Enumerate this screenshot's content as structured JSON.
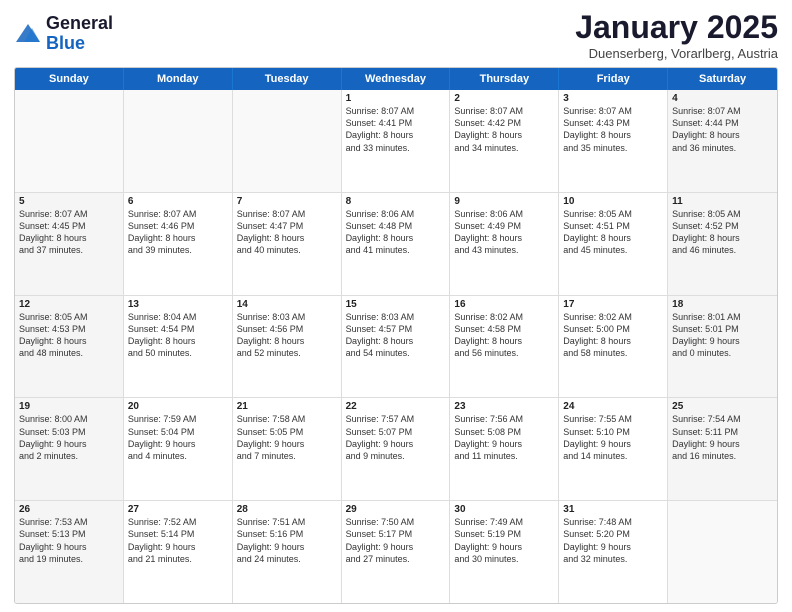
{
  "header": {
    "logo": {
      "general": "General",
      "blue": "Blue"
    },
    "title": "January 2025",
    "location": "Duenserberg, Vorarlberg, Austria"
  },
  "weekdays": [
    "Sunday",
    "Monday",
    "Tuesday",
    "Wednesday",
    "Thursday",
    "Friday",
    "Saturday"
  ],
  "rows": [
    [
      {
        "day": "",
        "text": "",
        "empty": true
      },
      {
        "day": "",
        "text": "",
        "empty": true
      },
      {
        "day": "",
        "text": "",
        "empty": true
      },
      {
        "day": "1",
        "text": "Sunrise: 8:07 AM\nSunset: 4:41 PM\nDaylight: 8 hours\nand 33 minutes."
      },
      {
        "day": "2",
        "text": "Sunrise: 8:07 AM\nSunset: 4:42 PM\nDaylight: 8 hours\nand 34 minutes."
      },
      {
        "day": "3",
        "text": "Sunrise: 8:07 AM\nSunset: 4:43 PM\nDaylight: 8 hours\nand 35 minutes."
      },
      {
        "day": "4",
        "text": "Sunrise: 8:07 AM\nSunset: 4:44 PM\nDaylight: 8 hours\nand 36 minutes.",
        "shaded": true
      }
    ],
    [
      {
        "day": "5",
        "text": "Sunrise: 8:07 AM\nSunset: 4:45 PM\nDaylight: 8 hours\nand 37 minutes.",
        "shaded": true
      },
      {
        "day": "6",
        "text": "Sunrise: 8:07 AM\nSunset: 4:46 PM\nDaylight: 8 hours\nand 39 minutes."
      },
      {
        "day": "7",
        "text": "Sunrise: 8:07 AM\nSunset: 4:47 PM\nDaylight: 8 hours\nand 40 minutes."
      },
      {
        "day": "8",
        "text": "Sunrise: 8:06 AM\nSunset: 4:48 PM\nDaylight: 8 hours\nand 41 minutes."
      },
      {
        "day": "9",
        "text": "Sunrise: 8:06 AM\nSunset: 4:49 PM\nDaylight: 8 hours\nand 43 minutes."
      },
      {
        "day": "10",
        "text": "Sunrise: 8:05 AM\nSunset: 4:51 PM\nDaylight: 8 hours\nand 45 minutes."
      },
      {
        "day": "11",
        "text": "Sunrise: 8:05 AM\nSunset: 4:52 PM\nDaylight: 8 hours\nand 46 minutes.",
        "shaded": true
      }
    ],
    [
      {
        "day": "12",
        "text": "Sunrise: 8:05 AM\nSunset: 4:53 PM\nDaylight: 8 hours\nand 48 minutes.",
        "shaded": true
      },
      {
        "day": "13",
        "text": "Sunrise: 8:04 AM\nSunset: 4:54 PM\nDaylight: 8 hours\nand 50 minutes."
      },
      {
        "day": "14",
        "text": "Sunrise: 8:03 AM\nSunset: 4:56 PM\nDaylight: 8 hours\nand 52 minutes."
      },
      {
        "day": "15",
        "text": "Sunrise: 8:03 AM\nSunset: 4:57 PM\nDaylight: 8 hours\nand 54 minutes."
      },
      {
        "day": "16",
        "text": "Sunrise: 8:02 AM\nSunset: 4:58 PM\nDaylight: 8 hours\nand 56 minutes."
      },
      {
        "day": "17",
        "text": "Sunrise: 8:02 AM\nSunset: 5:00 PM\nDaylight: 8 hours\nand 58 minutes."
      },
      {
        "day": "18",
        "text": "Sunrise: 8:01 AM\nSunset: 5:01 PM\nDaylight: 9 hours\nand 0 minutes.",
        "shaded": true
      }
    ],
    [
      {
        "day": "19",
        "text": "Sunrise: 8:00 AM\nSunset: 5:03 PM\nDaylight: 9 hours\nand 2 minutes.",
        "shaded": true
      },
      {
        "day": "20",
        "text": "Sunrise: 7:59 AM\nSunset: 5:04 PM\nDaylight: 9 hours\nand 4 minutes."
      },
      {
        "day": "21",
        "text": "Sunrise: 7:58 AM\nSunset: 5:05 PM\nDaylight: 9 hours\nand 7 minutes."
      },
      {
        "day": "22",
        "text": "Sunrise: 7:57 AM\nSunset: 5:07 PM\nDaylight: 9 hours\nand 9 minutes."
      },
      {
        "day": "23",
        "text": "Sunrise: 7:56 AM\nSunset: 5:08 PM\nDaylight: 9 hours\nand 11 minutes."
      },
      {
        "day": "24",
        "text": "Sunrise: 7:55 AM\nSunset: 5:10 PM\nDaylight: 9 hours\nand 14 minutes."
      },
      {
        "day": "25",
        "text": "Sunrise: 7:54 AM\nSunset: 5:11 PM\nDaylight: 9 hours\nand 16 minutes.",
        "shaded": true
      }
    ],
    [
      {
        "day": "26",
        "text": "Sunrise: 7:53 AM\nSunset: 5:13 PM\nDaylight: 9 hours\nand 19 minutes.",
        "shaded": true
      },
      {
        "day": "27",
        "text": "Sunrise: 7:52 AM\nSunset: 5:14 PM\nDaylight: 9 hours\nand 21 minutes."
      },
      {
        "day": "28",
        "text": "Sunrise: 7:51 AM\nSunset: 5:16 PM\nDaylight: 9 hours\nand 24 minutes."
      },
      {
        "day": "29",
        "text": "Sunrise: 7:50 AM\nSunset: 5:17 PM\nDaylight: 9 hours\nand 27 minutes."
      },
      {
        "day": "30",
        "text": "Sunrise: 7:49 AM\nSunset: 5:19 PM\nDaylight: 9 hours\nand 30 minutes."
      },
      {
        "day": "31",
        "text": "Sunrise: 7:48 AM\nSunset: 5:20 PM\nDaylight: 9 hours\nand 32 minutes."
      },
      {
        "day": "",
        "text": "",
        "empty": true
      }
    ]
  ]
}
